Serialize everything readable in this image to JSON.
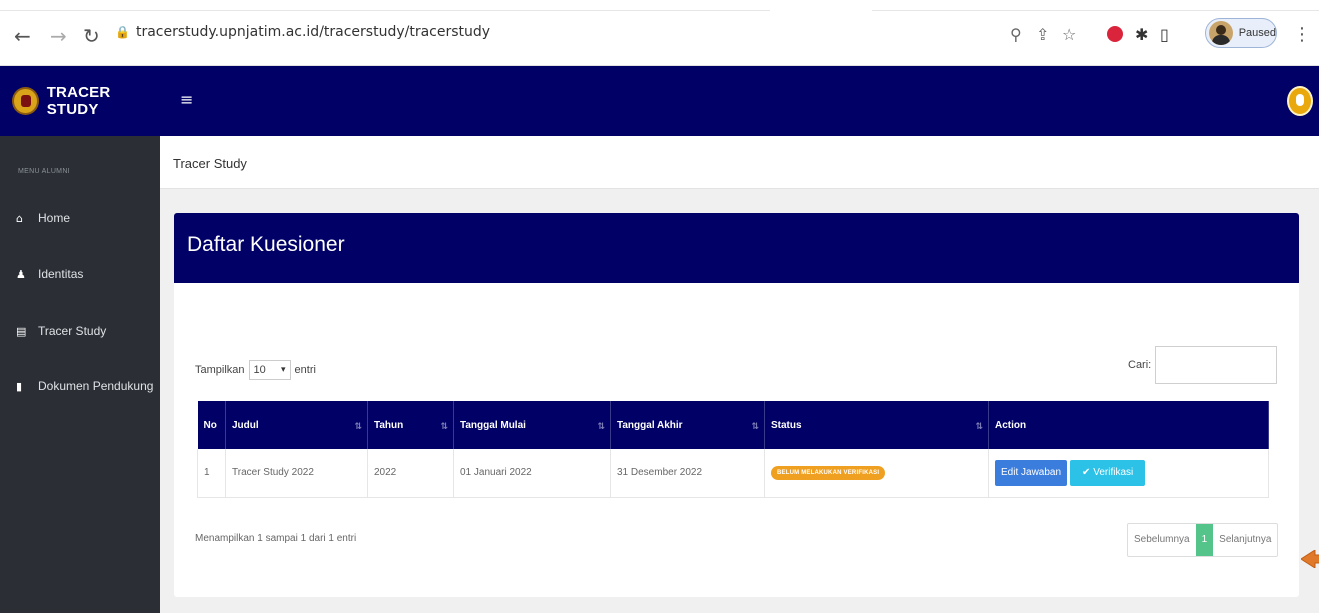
{
  "browser": {
    "url": "tracerstudy.upnjatim.ac.id/tracerstudy/tracerstudy",
    "profile_status": "Paused"
  },
  "header": {
    "app_title": "TRACER STUDY"
  },
  "sidebar": {
    "menu_header": "MENU ALUMNI",
    "items": [
      {
        "label": "Home",
        "icon": "home-icon"
      },
      {
        "label": "Identitas",
        "icon": "user-icon"
      },
      {
        "label": "Tracer Study",
        "icon": "document-icon"
      },
      {
        "label": "Dokumen Pendukung",
        "icon": "book-icon"
      }
    ]
  },
  "breadcrumb": "Tracer Study",
  "card": {
    "title": "Daftar Kuesioner",
    "show_prefix": "Tampilkan",
    "show_value": "10",
    "show_suffix": "entri",
    "search_label": "Cari:",
    "search_value": "",
    "columns": [
      "No",
      "Judul",
      "Tahun",
      "Tanggal Mulai",
      "Tanggal Akhir",
      "Status",
      "Action"
    ],
    "rows": [
      {
        "no": "1",
        "judul": "Tracer Study 2022",
        "tahun": "2022",
        "mulai": "01 Januari 2022",
        "akhir": "31 Desember 2022",
        "status": "BELUM MELAKUKAN VERIFIKASI",
        "edit_label": "Edit Jawaban",
        "verif_label": "Verifikasi"
      }
    ],
    "info": "Menampilkan 1 sampai 1 dari 1 entri",
    "pagination": {
      "prev": "Sebelumnya",
      "current": "1",
      "next": "Selanjutnya"
    }
  },
  "colors": {
    "navy": "#000066",
    "sidebar": "#2b2f35",
    "status_badge": "#f0a020",
    "edit_button": "#3b7ddd",
    "verify_button": "#2cc1e6",
    "pagination_active": "#55c48b",
    "annotation_arrow": "#e07a2a"
  }
}
